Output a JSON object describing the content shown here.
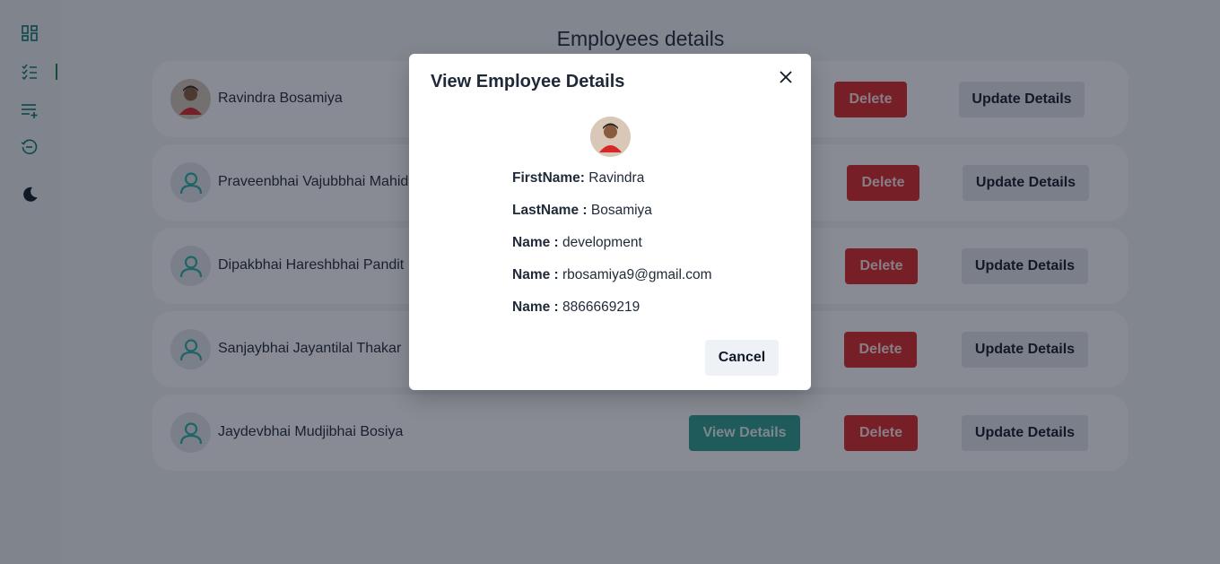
{
  "page": {
    "title": "Employees details"
  },
  "sidebar": {
    "items": [
      {
        "icon": "dashboard-icon"
      },
      {
        "icon": "checklist-icon"
      },
      {
        "icon": "add-list-icon"
      },
      {
        "icon": "history-icon"
      },
      {
        "icon": "moon-icon"
      }
    ],
    "active_color": "#15803d"
  },
  "employees": [
    {
      "name": "Ravindra Bosamiya",
      "has_photo": true,
      "delete_label": "Delete",
      "update_label": "Update Details"
    },
    {
      "name": "Praveenbhai Vajubbhai Mahida",
      "has_photo": false,
      "delete_label": "Delete",
      "update_label": "Update Details"
    },
    {
      "name": "Dipakbhai Hareshbhai Pandit",
      "has_photo": false,
      "delete_label": "Delete",
      "update_label": "Update Details"
    },
    {
      "name": "Sanjaybhai Jayantilal Thakar",
      "has_photo": false,
      "delete_label": "Delete",
      "update_label": "Update Details"
    },
    {
      "name": "Jaydevbhai Mudjibhai Bosiya",
      "has_photo": false,
      "view_label": "View Details",
      "delete_label": "Delete",
      "update_label": "Update Details"
    }
  ],
  "modal": {
    "title": "View Employee Details",
    "fields": [
      {
        "label": "FirstName:",
        "value": "Ravindra"
      },
      {
        "label": "LastName :",
        "value": "Bosamiya"
      },
      {
        "label": "Name :",
        "value": "development"
      },
      {
        "label": "Name :",
        "value": "rbosamiya9@gmail.com"
      },
      {
        "label": "Name :",
        "value": "8866669219"
      }
    ],
    "cancel_label": "Cancel"
  },
  "colors": {
    "view": "#2f9e8f",
    "delete": "#dc2626",
    "update": "#e5e7eb",
    "accent_icon": "#0f766e",
    "person_icon": "#2cb3a8"
  }
}
